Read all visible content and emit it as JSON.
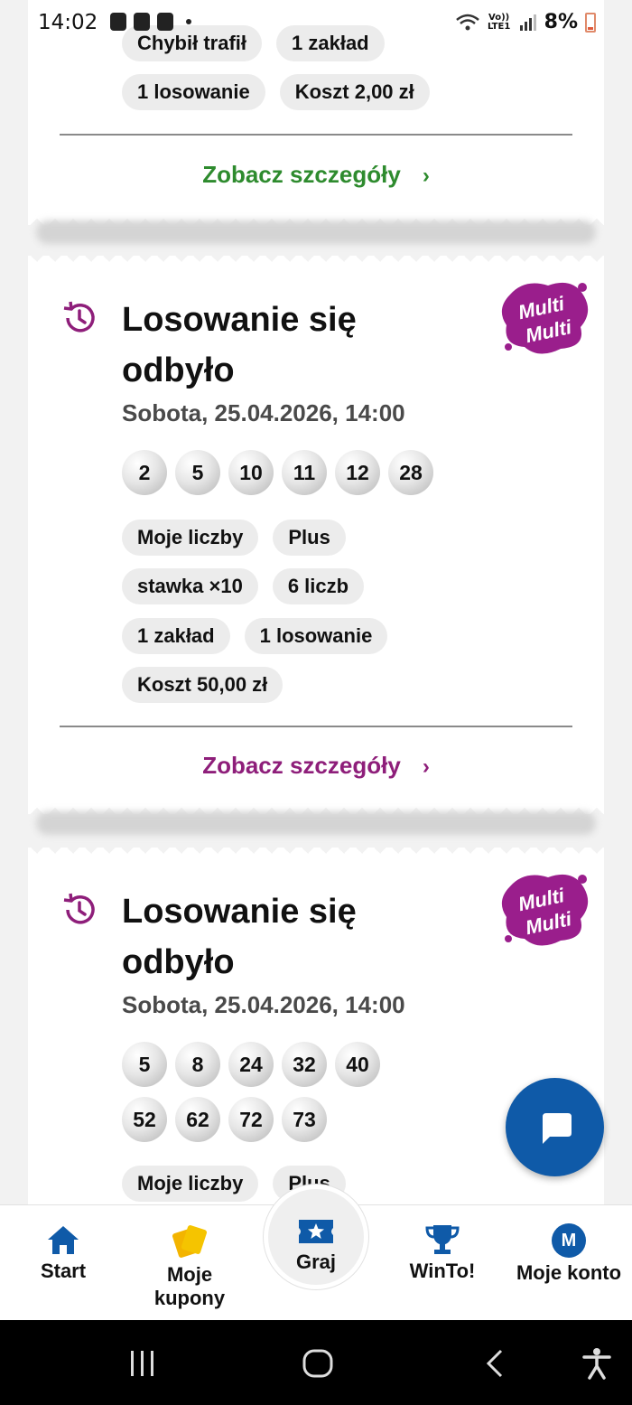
{
  "status_bar": {
    "time": "14:02",
    "battery": "8%",
    "network": "Vo)) LTE1"
  },
  "card_top": {
    "pills_row1": [
      "Chybił trafił",
      "1 zakład"
    ],
    "pills_row2": [
      "1 losowanie",
      "Koszt 2,00 zł"
    ],
    "details_link": "Zobacz szczegóły",
    "accent": "#2e8b2e"
  },
  "card_middle": {
    "title": "Losowanie się odbyło",
    "date": "Sobota, 25.04.2026, 14:00",
    "logo_line1": "Multi",
    "logo_line2": "Multi",
    "balls": [
      "2",
      "5",
      "10",
      "11",
      "12",
      "28"
    ],
    "pills": {
      "row1": [
        "Moje liczby",
        "Plus"
      ],
      "row2": [
        "stawka ×10",
        "6 liczb"
      ],
      "row3": [
        "1 zakład",
        "1 losowanie"
      ],
      "row4": [
        "Koszt 50,00 zł"
      ]
    },
    "details_link": "Zobacz szczegóły",
    "accent": "#8e1e7a"
  },
  "card_bottom": {
    "title": "Losowanie się odbyło",
    "date": "Sobota, 25.04.2026, 14:00",
    "logo_line1": "Multi",
    "logo_line2": "Multi",
    "balls": [
      "5",
      "8",
      "24",
      "32",
      "40",
      "52",
      "62",
      "72",
      "73"
    ],
    "pills_row1": [
      "Moje liczby",
      "Plus"
    ]
  },
  "bottom_nav": {
    "items": [
      {
        "label": "Start",
        "icon": "home-icon"
      },
      {
        "label": "Moje kupony",
        "icon": "coupons-icon"
      },
      {
        "label": "Graj",
        "icon": "ticket-star-icon"
      },
      {
        "label": "WinTo!",
        "icon": "trophy-icon"
      },
      {
        "label": "Moje konto",
        "icon": "account-avatar-icon",
        "avatar_letter": "M"
      }
    ]
  },
  "colors": {
    "brand_blue": "#0f5aa8",
    "multi_purple": "#9a1e8c"
  }
}
